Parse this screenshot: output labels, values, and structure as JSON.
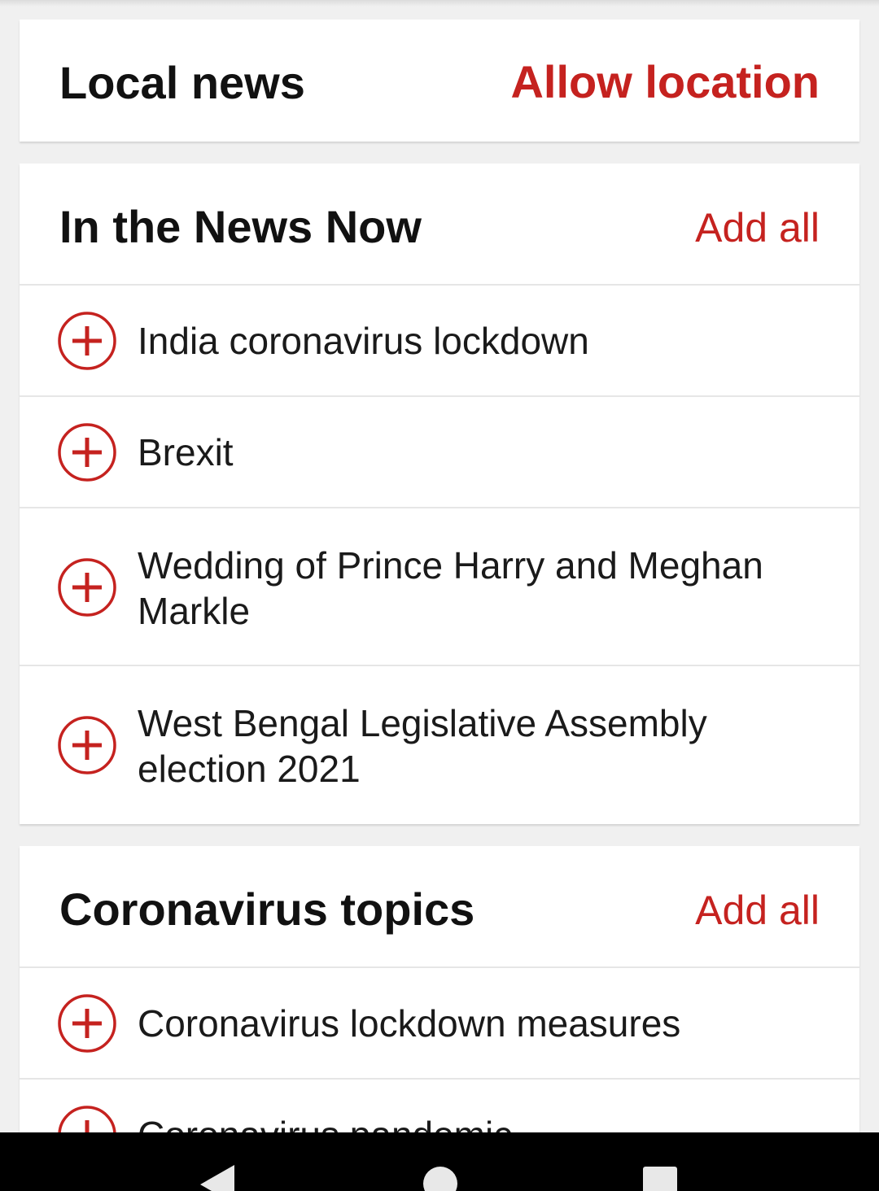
{
  "local_news": {
    "title": "Local news",
    "action_label": "Allow location"
  },
  "in_the_news_now": {
    "title": "In the News Now",
    "action_label": "Add all",
    "items": [
      {
        "label": "India coronavirus lockdown"
      },
      {
        "label": "Brexit"
      },
      {
        "label": "Wedding of Prince Harry and Meghan Markle"
      },
      {
        "label": "West Bengal Legislative Assembly election 2021"
      }
    ]
  },
  "coronavirus_topics": {
    "title": "Coronavirus topics",
    "action_label": "Add all",
    "items": [
      {
        "label": "Coronavirus lockdown measures"
      },
      {
        "label": "Coronavirus pandemic"
      }
    ]
  },
  "colors": {
    "accent": "#c5221f",
    "background": "#f0f0f0",
    "card": "#ffffff"
  },
  "icons": {
    "add": "plus-circle-icon",
    "nav_back": "back-triangle-icon",
    "nav_home": "home-circle-icon",
    "nav_recents": "recents-square-icon"
  }
}
